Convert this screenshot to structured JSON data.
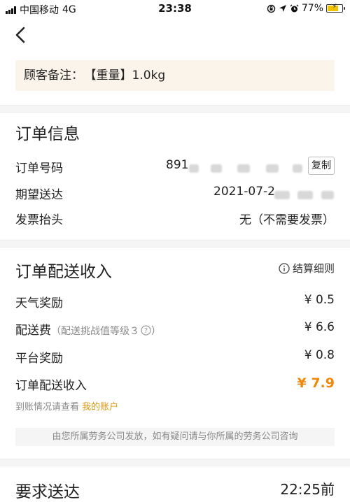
{
  "status_bar": {
    "carrier": "中国移动",
    "network": "4G",
    "time": "23:38",
    "battery_percent": "77%",
    "battery_level": 0.77
  },
  "remark": {
    "label": "顾客备注：",
    "value": "【重量】1.0kg"
  },
  "order_info": {
    "title": "订单信息",
    "order_no_label": "订单号码",
    "order_no_value": "891",
    "copy_label": "复制",
    "expected_label": "期望送达",
    "expected_value": "2021-07-2",
    "invoice_label": "发票抬头",
    "invoice_value": "无（不需要发票）"
  },
  "income": {
    "title": "订单配送收入",
    "settlement_label": "结算细则",
    "items": [
      {
        "label": "天气奖励",
        "sub": "",
        "value": "¥ 0.5"
      },
      {
        "label": "配送费",
        "sub": "（配送挑战值等级３",
        "value": "¥ 6.6"
      },
      {
        "label": "平台奖励",
        "sub": "",
        "value": "¥ 0.8"
      }
    ],
    "sub_close": "）",
    "total_label": "订单配送收入",
    "total_value": "¥ 7.9",
    "account_tip": "到账情况请查看",
    "account_link": "我的账户",
    "notice": "由您所属劳务公司发放，如有疑问请与你所属的劳务公司咨询"
  },
  "deadline": {
    "title": "要求送达",
    "time": "22:25前"
  },
  "colors": {
    "accent": "#f0890b",
    "link": "#d99a10",
    "remark_bg": "#fbf4ea"
  }
}
